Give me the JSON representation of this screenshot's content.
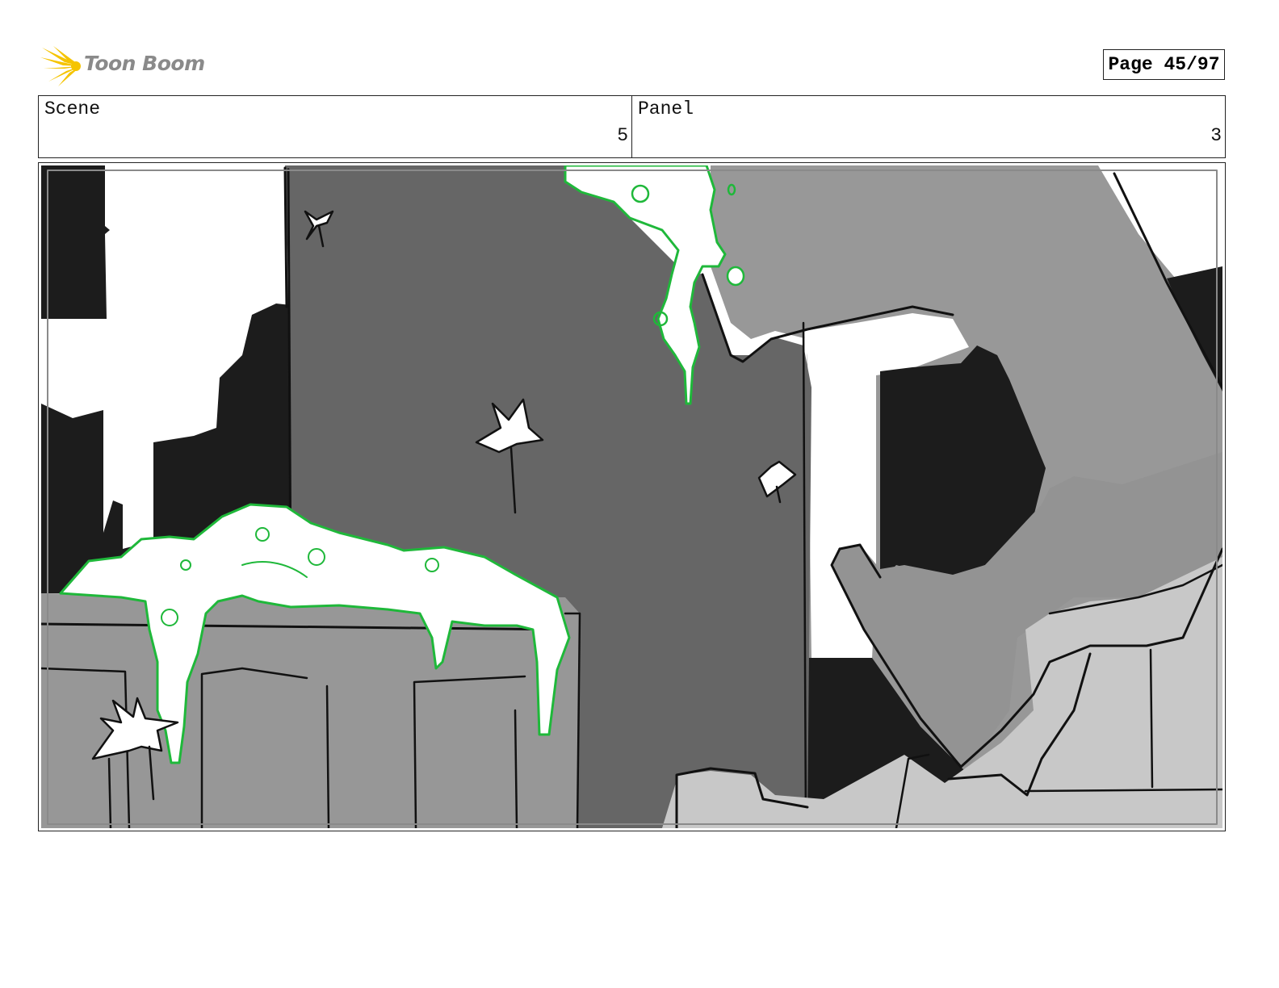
{
  "header": {
    "logo_text": "Toon Boom",
    "page_label": "Page 45/97"
  },
  "info": {
    "scene_label": "Scene",
    "scene_value": "5",
    "panel_label": "Panel",
    "panel_value": "3"
  },
  "colors": {
    "logo_yellow": "#f5c400",
    "slime_outline": "#1fb83a",
    "dark": "#1c1c1c",
    "mid_gray": "#676767",
    "light_gray": "#979797",
    "pale_gray": "#c8c8c8"
  },
  "icons": {
    "logo": "starburst-logo-icon"
  }
}
